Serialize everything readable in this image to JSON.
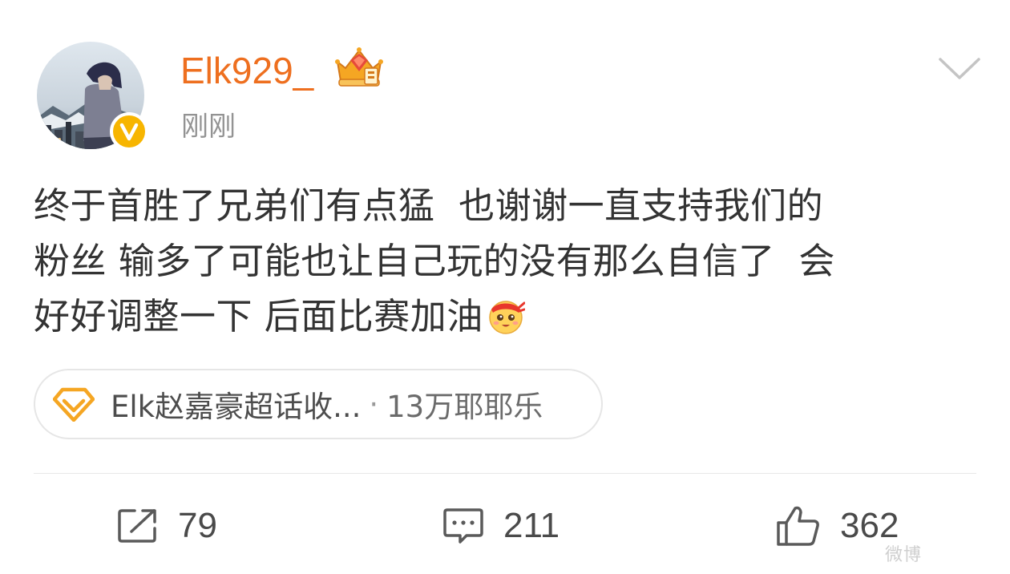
{
  "user": {
    "name": "Elk929_",
    "timestamp": "刚刚"
  },
  "post": {
    "lines": [
      "终于首胜了兄弟们有点猛  也谢谢一直支持我们的",
      "粉丝 输多了可能也让自己玩的没有那么自信了  会",
      "好好调整一下 后面比赛加油"
    ],
    "emoji": "cheer-emoji"
  },
  "topic": {
    "name": "Elk赵嘉豪超话收...",
    "separator": "·",
    "count": "13万耶耶乐"
  },
  "actions": {
    "repost_count": "79",
    "comment_count": "211",
    "like_count": "362"
  },
  "colors": {
    "username": "#ee6f1f",
    "verified": "#f7b500",
    "topic_icon": "#f5a623"
  },
  "watermark": "微博"
}
